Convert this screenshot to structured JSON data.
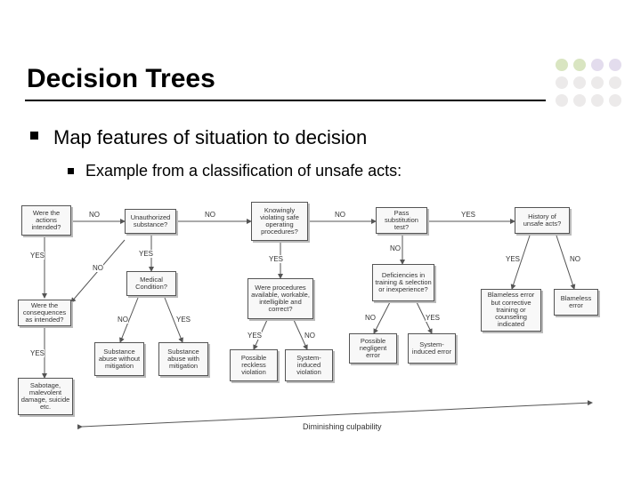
{
  "title": "Decision Trees",
  "bullet1": "Map features of situation to decision",
  "bullet2": "Example from a classification of unsafe acts:",
  "labels": {
    "yes": "YES",
    "no": "NO"
  },
  "nodes": {
    "n1": "Were the actions intended?",
    "n2": "Unauthorized substance?",
    "n3": "Knowingly violating safe operating procedures?",
    "n4": "Pass substitution test?",
    "n5": "History of unsafe acts?",
    "n6": "Medical Condition?",
    "n7": "Were the consequences as intended?",
    "n8": "Were procedures available, workable, intelligible and correct?",
    "n9": "Deficiencies in training & selection or inexperience?",
    "t1": "Sabotage, malevolent damage, suicide etc.",
    "t2": "Substance abuse without mitigation",
    "t3": "Substance abuse with mitigation",
    "t4": "Possible reckless violation",
    "t5": "System-induced violation",
    "t6": "Possible negligent error",
    "t7": "System-induced error",
    "t8": "Blameless error but corrective training or counseling indicated",
    "t9": "Blameless error"
  },
  "bottom_label": "Diminishing culpability"
}
